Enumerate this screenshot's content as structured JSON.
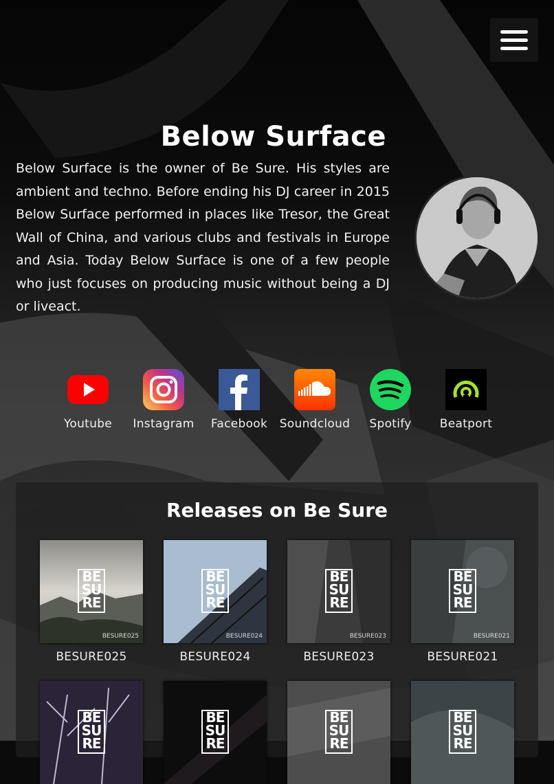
{
  "header": {
    "title": "Below Surface"
  },
  "bio": "Below Surface is the owner of Be Sure. His styles are ambient and techno. Before ending his DJ career in 2015 Below Surface performed in places like Tresor, the Great Wall of China, and various clubs and festivals in Europe and Asia. Today Below Surface is one of a few people who just focuses on producing music without being a DJ or liveact.",
  "socials": [
    {
      "label": "Youtube",
      "icon": "youtube-icon"
    },
    {
      "label": "Instagram",
      "icon": "instagram-icon"
    },
    {
      "label": "Facebook",
      "icon": "facebook-icon"
    },
    {
      "label": "Soundcloud",
      "icon": "soundcloud-icon"
    },
    {
      "label": "Spotify",
      "icon": "spotify-icon"
    },
    {
      "label": "Beatport",
      "icon": "beatport-icon"
    }
  ],
  "releases": {
    "title": "Releases on Be Sure",
    "logo": [
      "BE",
      "SU",
      "RE"
    ],
    "items": [
      {
        "code": "BESURE025",
        "small": "BESURE025"
      },
      {
        "code": "BESURE024",
        "small": "BESURE024"
      },
      {
        "code": "BESURE023",
        "small": "BESURE023"
      },
      {
        "code": "BESURE021",
        "small": "BESURE021"
      },
      {
        "code": "",
        "small": ""
      },
      {
        "code": "",
        "small": ""
      },
      {
        "code": "",
        "small": ""
      },
      {
        "code": "",
        "small": ""
      }
    ]
  },
  "colors": {
    "youtube": "#ff0000",
    "facebook": "#3b5998",
    "soundcloud": "#ff5500",
    "spotify": "#1ed760",
    "beatport": "#a6e22e"
  }
}
